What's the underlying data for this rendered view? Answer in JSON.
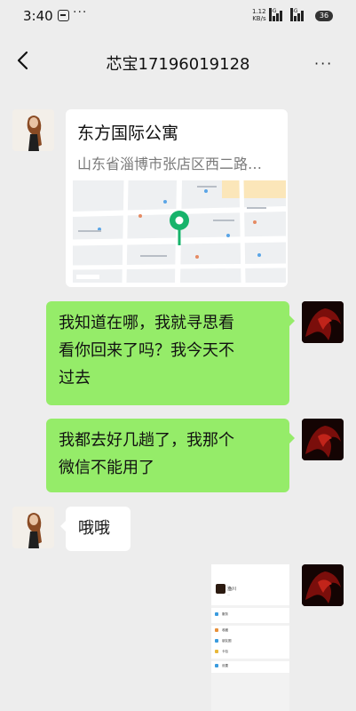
{
  "status_bar": {
    "time": "3:40",
    "net_speed_value": "1.12",
    "net_speed_unit": "KB/s",
    "signal_1": "5G",
    "signal_2": "5G",
    "battery": "36"
  },
  "nav": {
    "title": "芯宝17196019128"
  },
  "messages": {
    "location": {
      "name": "东方国际公寓",
      "address": "山东省淄博市张店区西二路…"
    },
    "m1": {
      "line1": "我知道在哪，我就寻思看",
      "line2": "看你回来了吗？我今天不",
      "line3": "过去"
    },
    "m2": {
      "line1": "我都去好几趟了，我那个",
      "line2": "微信不能用了"
    },
    "m3": {
      "text": "哦哦"
    },
    "screenshot": {
      "name": "渔川",
      "rows": [
        "服务",
        "收藏",
        "朋友圈",
        "卡包",
        "设置"
      ]
    }
  },
  "colors": {
    "background": "#ededed",
    "bubble_self": "#95ec69",
    "bubble_other": "#ffffff",
    "map_pin": "#17b36b"
  }
}
